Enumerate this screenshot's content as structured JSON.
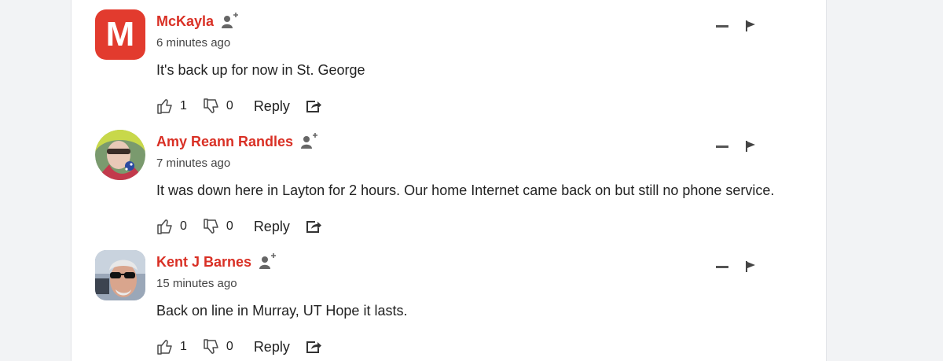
{
  "comments": [
    {
      "author": "McKayla",
      "avatar_letter": "M",
      "time": "6 minutes ago",
      "text": "It's back up for now in St. George",
      "likes": "1",
      "dislikes": "0",
      "reply_label": "Reply"
    },
    {
      "author": "Amy Reann Randles",
      "time": "7 minutes ago",
      "text": "It was down here in Layton for 2 hours. Our home Internet came back on but still no phone service.",
      "likes": "0",
      "dislikes": "0",
      "reply_label": "Reply"
    },
    {
      "author": "Kent J Barnes",
      "time": "15 minutes ago",
      "text": "Back on line in Murray, UT Hope it lasts.",
      "likes": "1",
      "dislikes": "0",
      "reply_label": "Reply"
    }
  ],
  "colors": {
    "author_name": "#d93025",
    "avatar_bg": "#e23b2e",
    "page_bg": "#f2f3f5"
  },
  "icons": {
    "follow": "user-plus-icon",
    "like": "thumbs-up-icon",
    "dislike": "thumbs-down-icon",
    "share": "share-icon",
    "collapse": "minus-icon",
    "flag": "flag-icon"
  }
}
